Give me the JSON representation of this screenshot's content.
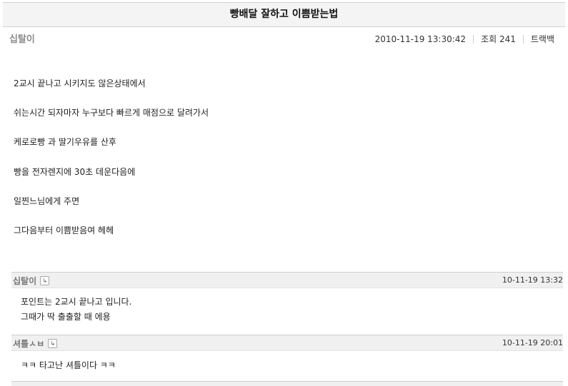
{
  "post": {
    "title": "빵배달 잘하고 이쁨받는법",
    "author": "십탈이",
    "datetime": "2010-11-19 13:30:42",
    "views_label": "조회 241",
    "trackback_label": "트랙백",
    "content_lines": [
      "2교시 끝나고 시키지도 않은상태에서",
      "쉬는시간 되자마자 누구보다 빠르게 매점으로 달려가서",
      "케로로빵 과 딸기우유를 산후",
      "빵을 전자렌지에 30초 데운다음에",
      "일찐느님에게 주면",
      "그다음부터 이쁨받음여 헤헤"
    ]
  },
  "comments": [
    {
      "author": "십탈이",
      "time": "10-11-19 13:32",
      "lines": [
        "포인트는 2교시 끝나고 입니다.",
        "그때가 딱 출출할 때 에용"
      ]
    },
    {
      "author": "셔틀ㅅㅂ",
      "time": "10-11-19 20:01",
      "lines": [
        "ㅋㅋ 타고난 셔틀이다 ㅋㅋ"
      ]
    }
  ],
  "icons": {
    "reply": "reply-icon"
  }
}
